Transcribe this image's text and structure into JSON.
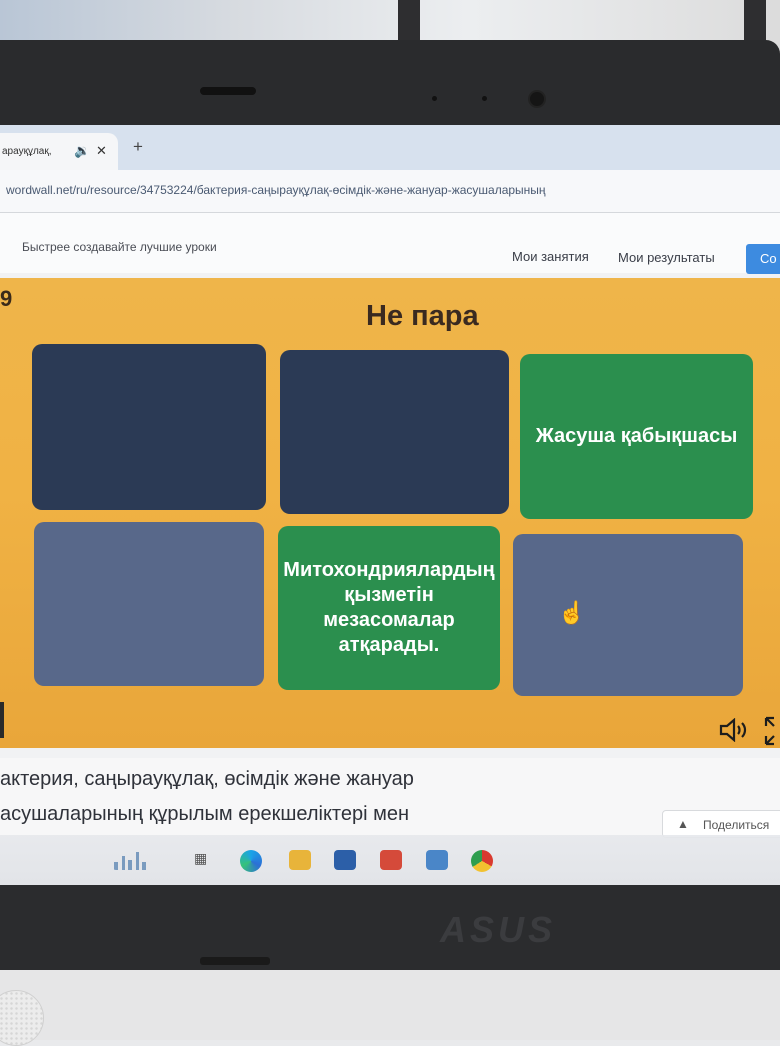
{
  "browser": {
    "tab": {
      "title": "арауқұлақ, ",
      "audio_icon": "speaker-icon",
      "close_icon": "close-icon"
    },
    "new_tab_label": "+",
    "url": "wordwall.net/ru/resource/34753224/бактерия-саңырауқұлақ-өсімдік-және-жануар-жасушаларының"
  },
  "site_header": {
    "tagline": "Быстрее создавайте лучшие уроки",
    "nav": [
      "Мои занятия",
      "Мои результаты"
    ],
    "create_label": "Со"
  },
  "game": {
    "counter": "9",
    "title": "Не пара",
    "cards": [
      {
        "text": "",
        "state": "hidden-dark"
      },
      {
        "text": "",
        "state": "hidden-dark"
      },
      {
        "text": "Жасуша қабықшасы",
        "state": "revealed"
      },
      {
        "text": "",
        "state": "hidden-slate"
      },
      {
        "text": "Митохондриялардың қызметін мезасомалар атқарады.",
        "state": "revealed"
      },
      {
        "text": "",
        "state": "hidden-slate"
      }
    ],
    "colors": {
      "background": "#efb54a",
      "hidden_dark": "#2b3a55",
      "hidden_slate": "#58688a",
      "revealed": "#2b8f4e"
    }
  },
  "description": {
    "line1": "актерия, саңырауқұлақ, өсімдік және жануар",
    "line2": "асушаларының құрылым ерекшеліктері мен"
  },
  "share": {
    "label": "Поделиться",
    "icon": "person-icon"
  },
  "taskbar": {
    "icons": [
      "widgets-icon",
      "task-view-icon",
      "edge-icon",
      "file-explorer-icon",
      "mail-icon",
      "office-icon",
      "photos-icon",
      "chrome-icon"
    ]
  },
  "laptop": {
    "brand": "ASUS"
  }
}
